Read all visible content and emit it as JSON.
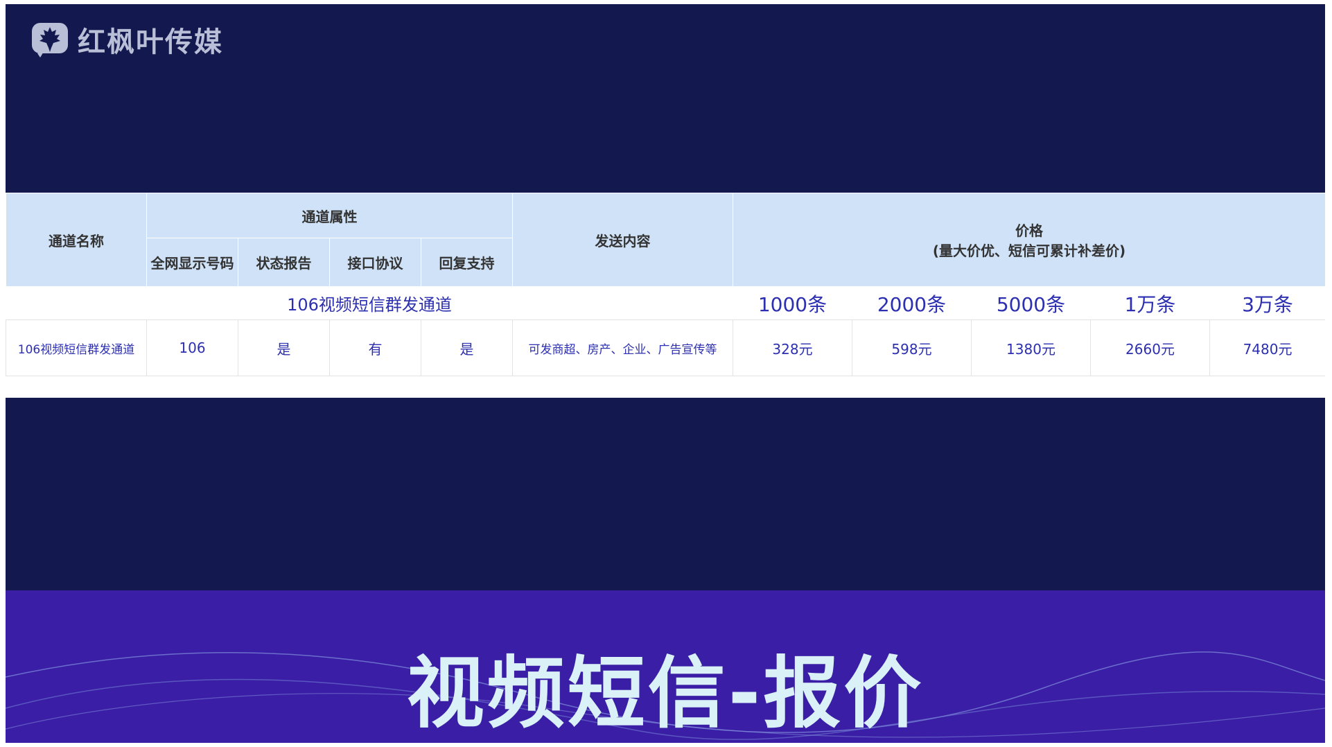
{
  "logo": {
    "text": "红枫叶传媒"
  },
  "table": {
    "col_channel_name": "通道名称",
    "group_attributes": "通道属性",
    "attr_headers": [
      "全网显示号码",
      "状态报告",
      "接口协议",
      "回复支持"
    ],
    "col_content": "发送内容",
    "price_title": "价格",
    "price_note": "(量大价优、短信可累计补差价)",
    "channel_banner": "106视频短信群发通道",
    "quantities": [
      "1000条",
      "2000条",
      "5000条",
      "1万条",
      "3万条"
    ],
    "row": {
      "name": "106视频短信群发通道",
      "number": "106",
      "status_report": "是",
      "protocol": "有",
      "reply": "是",
      "content": "可发商超、房产、企业、广告宣传等",
      "prices": [
        "328元",
        "598元",
        "1380元",
        "2660元",
        "7480元"
      ]
    }
  },
  "banner": {
    "title": "视频短信-报价"
  },
  "colors": {
    "navy": "#13184f",
    "purple": "#3a1fa6",
    "header_blue": "#cfe2f7",
    "text_blue": "#2c2fb0",
    "title_cyan": "#d9f1f7"
  }
}
